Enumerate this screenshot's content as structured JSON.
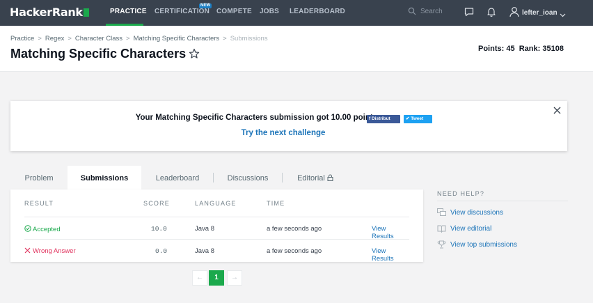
{
  "nav": {
    "logo": "HackerRank",
    "links": [
      "PRACTICE",
      "CERTIFICATION",
      "COMPETE",
      "JOBS",
      "LEADERBOARD"
    ],
    "new_badge": "NEW",
    "search_placeholder": "Search",
    "username": "lefter_ioan",
    "colors": {
      "bar": "#39424e",
      "accent": "#1ba94c"
    }
  },
  "breadcrumb": [
    "Practice",
    "Regex",
    "Character Class",
    "Matching Specific Characters",
    "Submissions"
  ],
  "page_title": "Matching Specific Characters",
  "stats": {
    "points_label": "Points:",
    "points": "45",
    "rank_label": "Rank:",
    "rank": "35108"
  },
  "banner": {
    "message": "Your Matching Specific Characters submission got 10.00 points.",
    "share_facebook": "Distribut",
    "share_twitter": "Tweet",
    "next_link": "Try the next challenge"
  },
  "tabs": [
    "Problem",
    "Submissions",
    "Leaderboard",
    "Discussions",
    "Editorial"
  ],
  "table": {
    "headers": [
      "RESULT",
      "SCORE",
      "LANGUAGE",
      "TIME"
    ],
    "rows": [
      {
        "result": "Accepted",
        "score": "10.0",
        "language": "Java 8",
        "time": "a few seconds ago",
        "action": "View Results"
      },
      {
        "result": "Wrong Answer",
        "score": "0.0",
        "language": "Java 8",
        "time": "a few seconds ago",
        "action": "View Results"
      }
    ]
  },
  "pagination": {
    "current": "1"
  },
  "help": {
    "title": "NEED HELP?",
    "items": [
      "View discussions",
      "View editorial",
      "View top submissions"
    ]
  }
}
